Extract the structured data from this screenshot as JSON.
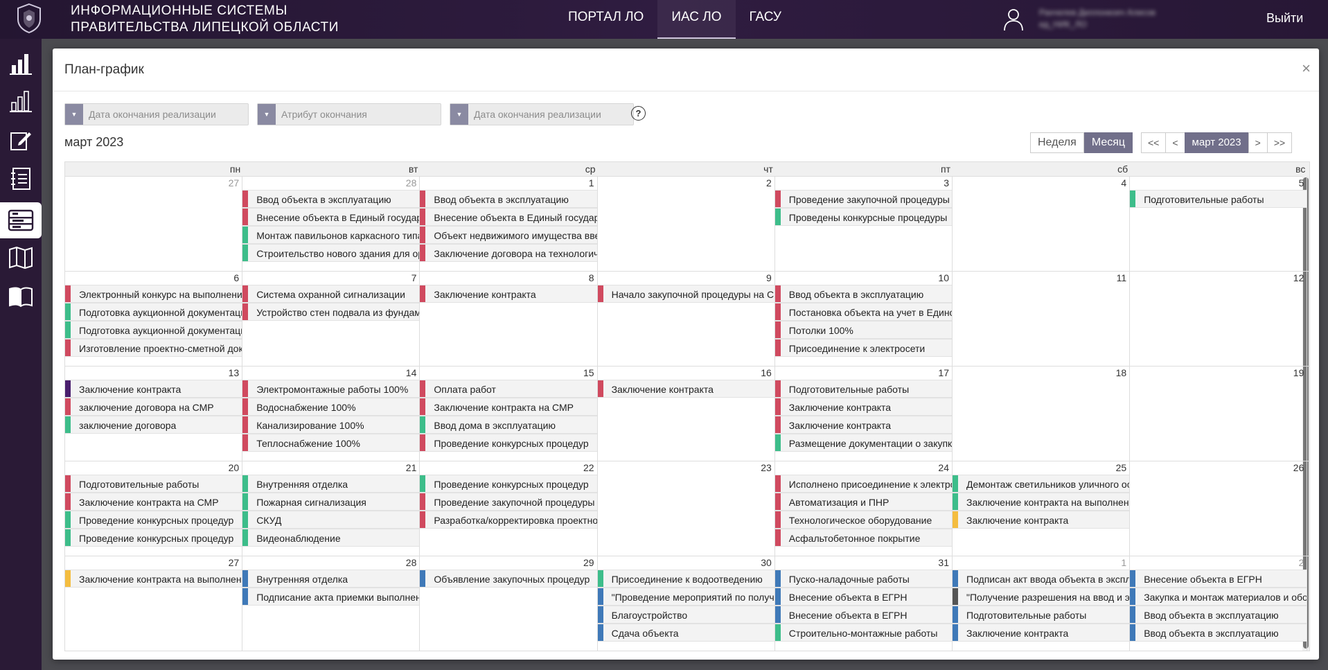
{
  "header": {
    "system_name_line1": "ИНФОРМАЦИОННЫЕ СИСТЕМЫ",
    "system_name_line2": "ПРАВИТЕЛЬСТВА ЛИПЕЦКОЙ ОБЛАСТИ",
    "nav": [
      {
        "label": "ПОРТАЛ ЛО",
        "active": false
      },
      {
        "label": "ИАС ЛО",
        "active": true
      },
      {
        "label": "ГАСУ",
        "active": false
      }
    ],
    "user_name_line1": "Ранчелев Диллонкоеч Алисов",
    "user_name_line2": "ид_НИК_ЛО",
    "logout_label": "Выйти"
  },
  "sidebar": {
    "items": [
      {
        "icon": "bar-chart-icon",
        "active": false
      },
      {
        "icon": "bar-chart-outline-icon",
        "active": false
      },
      {
        "icon": "edit-icon",
        "active": false
      },
      {
        "icon": "notebook-icon",
        "active": false
      },
      {
        "icon": "schedule-icon",
        "active": true
      },
      {
        "icon": "map-icon",
        "active": false
      },
      {
        "icon": "book-icon",
        "active": false
      }
    ]
  },
  "modal": {
    "title": "План-график",
    "close_label": "×",
    "filters": [
      {
        "placeholder": "Дата окончания реализации"
      },
      {
        "placeholder": "Атрибут окончания"
      },
      {
        "placeholder": "Дата окончания реализации"
      }
    ],
    "help_label": "?",
    "month_label": "март 2023",
    "view_toggle": [
      {
        "label": "Неделя",
        "active": false
      },
      {
        "label": "Месяц",
        "active": true
      }
    ],
    "pager": {
      "first": "<<",
      "prev": "<",
      "current": "март 2023",
      "next": ">",
      "last": ">>"
    }
  },
  "colors": {
    "red": "#d04a5f",
    "green": "#3dbd8a",
    "blue": "#3f79b8",
    "purple": "#4a1f6e",
    "yellow": "#f4bd40",
    "gray": "#555555"
  },
  "calendar": {
    "weekdays": [
      "пн",
      "вт",
      "ср",
      "чт",
      "пт",
      "сб",
      "вс"
    ],
    "weeks": [
      {
        "days": [
          {
            "num": "27",
            "other": true,
            "events": []
          },
          {
            "num": "28",
            "other": true,
            "events": [
              {
                "text": "Ввод объекта в эксплуатацию",
                "color": "red"
              },
              {
                "text": "Внесение объекта в Единый государственный реестр",
                "color": "red"
              },
              {
                "text": "Монтаж павильонов каркасного типа",
                "color": "green"
              },
              {
                "text": "Строительство нового здания для организации",
                "color": "green"
              }
            ]
          },
          {
            "num": "1",
            "other": false,
            "events": [
              {
                "text": "Ввод объекта в эксплуатацию",
                "color": "red"
              },
              {
                "text": "Внесение объекта в Единый государственный реестр",
                "color": "red"
              },
              {
                "text": "Объект недвижимого имущества введен",
                "color": "red"
              },
              {
                "text": "Заключение договора на технологическое присоединение",
                "color": "red"
              }
            ]
          },
          {
            "num": "2",
            "other": false,
            "events": []
          },
          {
            "num": "3",
            "other": false,
            "events": [
              {
                "text": "Проведение закупочной процедуры",
                "color": "red"
              },
              {
                "text": "Проведены конкурсные процедуры",
                "color": "green"
              }
            ]
          },
          {
            "num": "4",
            "other": false,
            "events": []
          },
          {
            "num": "5",
            "other": false,
            "events": [
              {
                "text": "Подготовительные работы",
                "color": "green"
              }
            ]
          }
        ]
      },
      {
        "days": [
          {
            "num": "6",
            "other": false,
            "events": [
              {
                "text": "Электронный конкурс на выполнение работ",
                "color": "red"
              },
              {
                "text": "Подготовка аукционной документации",
                "color": "green"
              },
              {
                "text": "Подготовка аукционной документации",
                "color": "green"
              },
              {
                "text": "Изготовление проектно-сметной документации",
                "color": "red"
              }
            ]
          },
          {
            "num": "7",
            "other": false,
            "events": [
              {
                "text": "Система охранной сигнализации",
                "color": "red"
              },
              {
                "text": "Устройство стен подвала из фундаментных блоков",
                "color": "red"
              }
            ]
          },
          {
            "num": "8",
            "other": false,
            "events": [
              {
                "text": "Заключение контракта",
                "color": "red"
              }
            ]
          },
          {
            "num": "9",
            "other": false,
            "events": [
              {
                "text": "Начало закупочной процедуры на СМР",
                "color": "red"
              }
            ]
          },
          {
            "num": "10",
            "other": false,
            "events": [
              {
                "text": "Ввод объекта в эксплуатацию",
                "color": "red"
              },
              {
                "text": "Постановка объекта на учет в Едином реестре",
                "color": "red"
              },
              {
                "text": "Потолки 100%",
                "color": "red"
              },
              {
                "text": "Присоединение к электросети",
                "color": "red"
              }
            ]
          },
          {
            "num": "11",
            "other": false,
            "events": []
          },
          {
            "num": "12",
            "other": false,
            "events": []
          }
        ]
      },
      {
        "days": [
          {
            "num": "13",
            "other": false,
            "events": [
              {
                "text": "Заключение контракта",
                "color": "purple"
              },
              {
                "text": "заключение договора на СМР",
                "color": "red"
              },
              {
                "text": "заключение договора",
                "color": "green"
              }
            ]
          },
          {
            "num": "14",
            "other": false,
            "events": [
              {
                "text": "Электромонтажные работы 100%",
                "color": "red"
              },
              {
                "text": "Водоснабжение 100%",
                "color": "red"
              },
              {
                "text": "Канализирование 100%",
                "color": "red"
              },
              {
                "text": "Теплоснабжение 100%",
                "color": "red"
              }
            ]
          },
          {
            "num": "15",
            "other": false,
            "events": [
              {
                "text": "Оплата работ",
                "color": "red"
              },
              {
                "text": "Заключение контракта на СМР",
                "color": "red"
              },
              {
                "text": "Ввод дома в эксплуатацию",
                "color": "green"
              },
              {
                "text": "Проведение конкурсных процедур",
                "color": "red"
              }
            ]
          },
          {
            "num": "16",
            "other": false,
            "events": [
              {
                "text": "Заключение контракта",
                "color": "red"
              }
            ]
          },
          {
            "num": "17",
            "other": false,
            "events": [
              {
                "text": "Подготовительные работы",
                "color": "red"
              },
              {
                "text": "Заключение контракта",
                "color": "red"
              },
              {
                "text": "Заключение контракта",
                "color": "red"
              },
              {
                "text": "Размещение документации о закупке",
                "color": "green"
              }
            ]
          },
          {
            "num": "18",
            "other": false,
            "events": []
          },
          {
            "num": "19",
            "other": false,
            "events": []
          }
        ]
      },
      {
        "days": [
          {
            "num": "20",
            "other": false,
            "events": [
              {
                "text": "Подготовительные работы",
                "color": "red"
              },
              {
                "text": "Заключение контракта на СМР",
                "color": "red"
              },
              {
                "text": "Проведение конкурсных процедур",
                "color": "green"
              },
              {
                "text": "Проведение конкурсных процедур",
                "color": "green"
              }
            ]
          },
          {
            "num": "21",
            "other": false,
            "events": [
              {
                "text": "Внутренняя отделка",
                "color": "green"
              },
              {
                "text": "Пожарная сигнализация",
                "color": "green"
              },
              {
                "text": "СКУД",
                "color": "green"
              },
              {
                "text": "Видеонаблюдение",
                "color": "green"
              }
            ]
          },
          {
            "num": "22",
            "other": false,
            "events": [
              {
                "text": "Проведение конкурсных процедур",
                "color": "green"
              },
              {
                "text": "Проведение закупочной процедуры",
                "color": "red"
              },
              {
                "text": "Разработка/корректировка проектной документации",
                "color": "red"
              }
            ]
          },
          {
            "num": "23",
            "other": false,
            "events": []
          },
          {
            "num": "24",
            "other": false,
            "events": [
              {
                "text": "Исполнено присоединение к электросетям",
                "color": "red"
              },
              {
                "text": "Автоматизация и ПНР",
                "color": "red"
              },
              {
                "text": "Технологическое оборудование",
                "color": "red"
              },
              {
                "text": "Асфальтобетонное покрытие",
                "color": "red"
              }
            ]
          },
          {
            "num": "25",
            "other": false,
            "events": [
              {
                "text": "Демонтаж светильников уличного освещения",
                "color": "green"
              },
              {
                "text": "Заключение контракта на выполнение работ",
                "color": "green"
              },
              {
                "text": "Заключение контракта",
                "color": "yellow"
              }
            ]
          },
          {
            "num": "26",
            "other": false,
            "events": []
          }
        ]
      },
      {
        "days": [
          {
            "num": "27",
            "other": false,
            "events": [
              {
                "text": "Заключение контракта на выполнение работ",
                "color": "yellow"
              }
            ]
          },
          {
            "num": "28",
            "other": false,
            "events": [
              {
                "text": "Внутренняя отделка",
                "color": "blue"
              },
              {
                "text": "Подписание акта приемки выполненных работ",
                "color": "blue"
              }
            ]
          },
          {
            "num": "29",
            "other": false,
            "events": [
              {
                "text": "Объявление закупочных процедур",
                "color": "blue"
              }
            ]
          },
          {
            "num": "30",
            "other": false,
            "events": [
              {
                "text": "Присоединение к водоотведению",
                "color": "green"
              },
              {
                "text": "\"Проведение мероприятий по получению",
                "color": "blue"
              },
              {
                "text": "Благоустройство",
                "color": "blue"
              },
              {
                "text": "Сдача объекта",
                "color": "blue"
              }
            ]
          },
          {
            "num": "31",
            "other": false,
            "events": [
              {
                "text": "Пуско-наладочные работы",
                "color": "blue"
              },
              {
                "text": "Внесение объекта в ЕГРН",
                "color": "blue"
              },
              {
                "text": "Внесение объекта в ЕГРН",
                "color": "blue"
              },
              {
                "text": "Строительно-монтажные работы",
                "color": "green"
              }
            ]
          },
          {
            "num": "1",
            "other": true,
            "events": [
              {
                "text": "Подписан акт ввода объекта в эксплуатацию",
                "color": "blue"
              },
              {
                "text": "\"Получение разрешения на ввод и эксплуатацию",
                "color": "gray"
              },
              {
                "text": "Подготовительные работы",
                "color": "blue"
              },
              {
                "text": "Заключение контракта",
                "color": "blue"
              }
            ]
          },
          {
            "num": "2",
            "other": true,
            "events": [
              {
                "text": "Внесение объекта в ЕГРН",
                "color": "blue"
              },
              {
                "text": "Закупка и монтаж материалов и оборудования",
                "color": "blue"
              },
              {
                "text": "Ввод объекта в эксплуатацию",
                "color": "blue"
              },
              {
                "text": "Ввод объекта в эксплуатацию",
                "color": "blue"
              }
            ]
          }
        ]
      }
    ]
  }
}
